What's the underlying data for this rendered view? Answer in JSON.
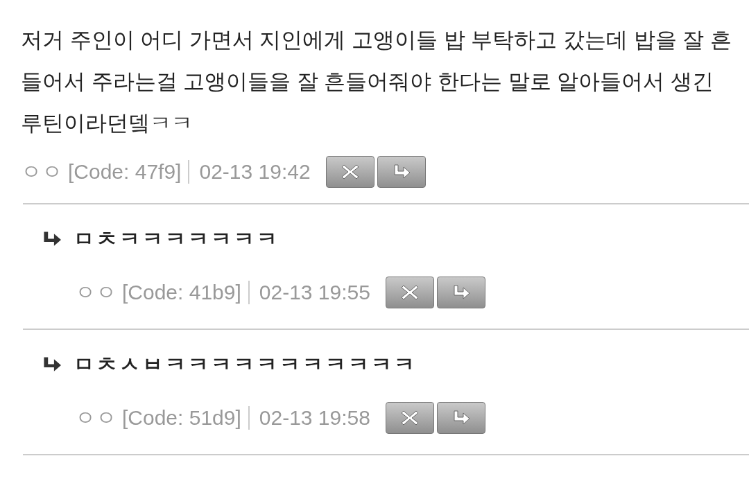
{
  "post": {
    "body": "저거 주인이 어디 가면서 지인에게 고앵이들 밥 부탁하고 갔는데 밥을 잘 흔들어서 주라는걸 고앵이들을 잘 흔들어줘야 한다는 말로 알아들어서 생긴 루틴이라던뎈ㅋㅋ",
    "author": "ㅇㅇ",
    "code": "[Code: 47f9]",
    "date": "02-13 19:42"
  },
  "replies": [
    {
      "text": "ㅁㅊㅋㅋㅋㅋㅋㅋㅋ",
      "author": "ㅇㅇ",
      "code": "[Code: 41b9]",
      "date": "02-13 19:55"
    },
    {
      "text": "ㅁㅊㅅㅂㅋㅋㅋㅋㅋㅋㅋㅋㅋㅋㅋ",
      "author": "ㅇㅇ",
      "code": "[Code: 51d9]",
      "date": "02-13 19:58"
    }
  ]
}
